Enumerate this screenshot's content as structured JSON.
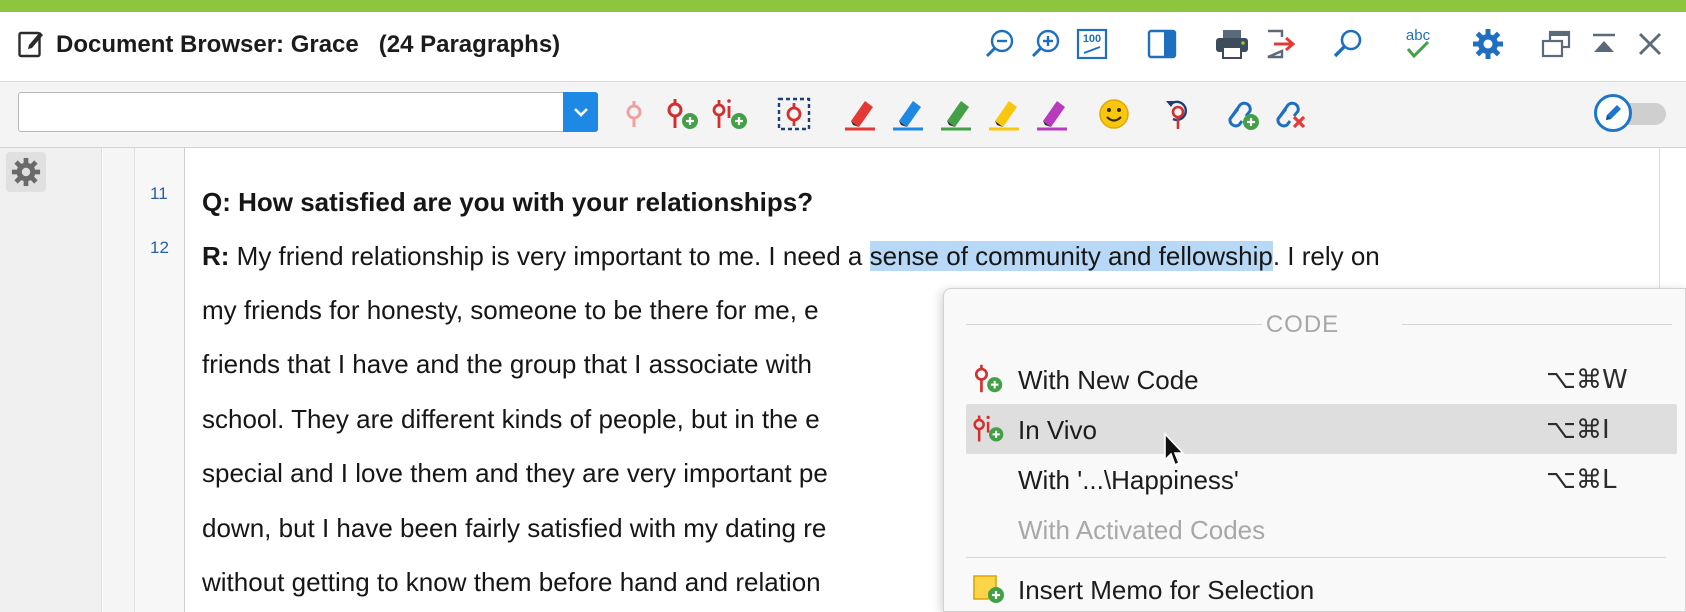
{
  "window": {
    "title": "Document Browser: Grace   (24 Paragraphs)",
    "accent_color": "#8cc63f"
  },
  "title_tools": [
    {
      "name": "zoom-out-icon"
    },
    {
      "name": "zoom-in-icon"
    },
    {
      "name": "zoom-100-icon",
      "text": "100"
    },
    {
      "name": "panel-toggle-icon"
    },
    {
      "name": "print-icon"
    },
    {
      "name": "export-icon"
    },
    {
      "name": "search-icon"
    },
    {
      "name": "spellcheck-icon",
      "text": "abc"
    },
    {
      "name": "gear-icon"
    },
    {
      "name": "undock-window-icon"
    },
    {
      "name": "collapse-up-icon"
    },
    {
      "name": "close-icon"
    }
  ],
  "toolbar": {
    "code_select_value": "",
    "tools": [
      {
        "name": "code-icon"
      },
      {
        "name": "code-with-new-code-icon"
      },
      {
        "name": "code-in-vivo-icon"
      },
      {
        "name": "code-selection-frame-icon"
      },
      {
        "name": "highlight-red-icon",
        "color": "#e53935"
      },
      {
        "name": "highlight-blue-icon",
        "color": "#1e88e5"
      },
      {
        "name": "highlight-green-icon",
        "color": "#43a047"
      },
      {
        "name": "highlight-yellow-icon",
        "color": "#f9c80e"
      },
      {
        "name": "highlight-purple-icon",
        "color": "#b93bbd"
      },
      {
        "name": "emoticode-smiley-icon"
      },
      {
        "name": "undo-code-icon"
      },
      {
        "name": "add-link-icon"
      },
      {
        "name": "remove-link-icon"
      }
    ],
    "edit_mode_on": false
  },
  "document": {
    "paragraph_numbers": [
      "11",
      "12"
    ],
    "lines": [
      {
        "speaker": "Q:",
        "text": " How satisfied are you with your relationships?",
        "bold_all": true
      },
      {
        "speaker": "R:",
        "text_before": " My friend relationship is very important to me. I need a ",
        "highlight": "sense of community and fellowship",
        "text_after": ". I rely on"
      },
      {
        "text": "my friends for honesty, someone to be there for me, e"
      },
      {
        "text": "friends that I have and the group that I associate with"
      },
      {
        "text": "school. They are different kinds of people, but in the e"
      },
      {
        "text": "special and I love them and they are very important pe"
      },
      {
        "text": "down, but I have been fairly satisfied with my dating re"
      },
      {
        "text": "without getting to know them before hand and relation"
      }
    ],
    "highlight_color": "#b7d8f7"
  },
  "context_menu": {
    "section_label": "CODE",
    "items": [
      {
        "label": "With New Code",
        "shortcut": "⌥⌘W",
        "icon": "code-with-new-code-icon",
        "enabled": true
      },
      {
        "label": "In Vivo",
        "shortcut": "⌥⌘I",
        "icon": "code-in-vivo-icon",
        "enabled": true,
        "hovered": true
      },
      {
        "label": "With '...\\Happiness'",
        "shortcut": "⌥⌘L",
        "icon": "",
        "enabled": true
      },
      {
        "label": "With Activated Codes",
        "shortcut": "",
        "icon": "",
        "enabled": false
      },
      {
        "label": "Insert Memo for Selection",
        "shortcut": "",
        "icon": "memo-add-icon",
        "enabled": true
      }
    ]
  }
}
